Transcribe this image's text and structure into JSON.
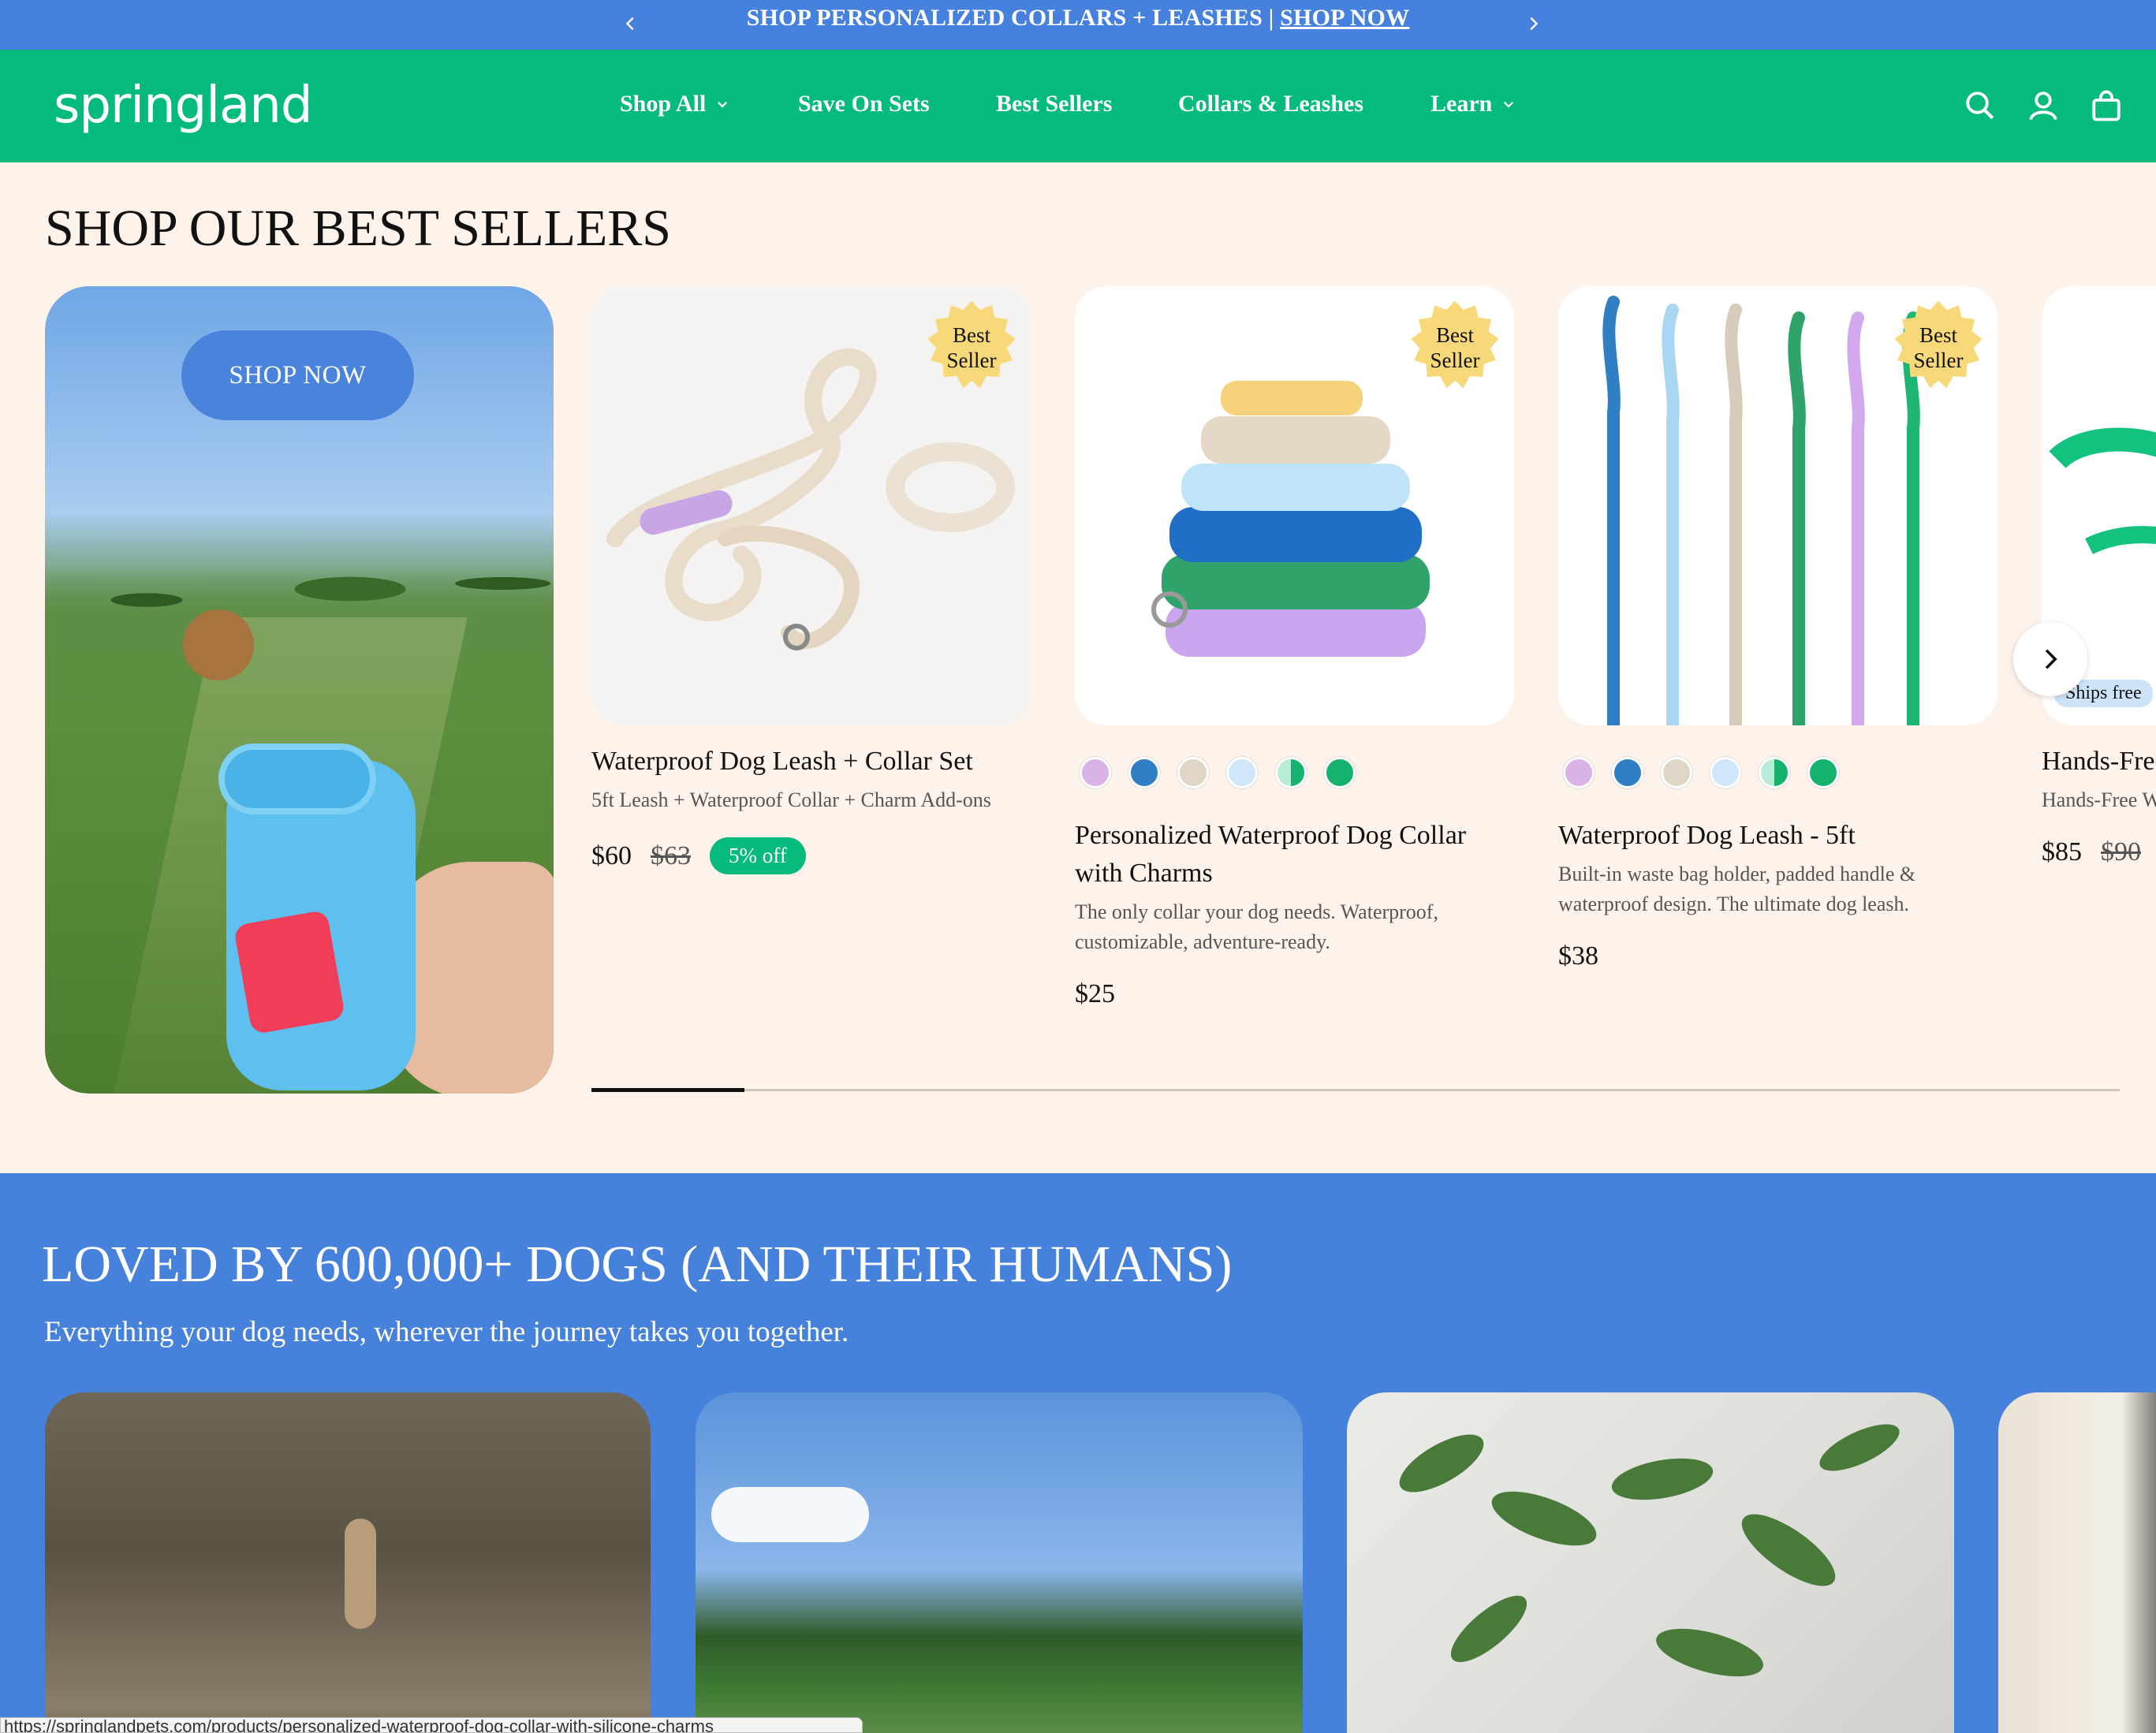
{
  "announcement": {
    "text": "SHOP PERSONALIZED COLLARS + LEASHES | ",
    "link": "SHOP NOW"
  },
  "header": {
    "logo": "springland",
    "nav": [
      {
        "label": "Shop All",
        "has_dropdown": true
      },
      {
        "label": "Save On Sets",
        "has_dropdown": false
      },
      {
        "label": "Best Sellers",
        "has_dropdown": false
      },
      {
        "label": "Collars & Leashes",
        "has_dropdown": false
      },
      {
        "label": "Learn",
        "has_dropdown": true
      }
    ],
    "icons": [
      "search-icon",
      "account-icon",
      "cart-icon"
    ]
  },
  "best_sellers": {
    "title": "SHOP OUR BEST SELLERS",
    "promo_button": "SHOP NOW",
    "products": [
      {
        "badge": "Best Seller",
        "name": "Waterproof Dog Leash + Collar Set",
        "desc": "5ft Leash + Waterproof Collar + Charm Add-ons",
        "price": "$60",
        "was": "$63",
        "discount": "5% off"
      },
      {
        "badge": "Best Seller",
        "name": "Personalized Waterproof Dog Collar with Charms",
        "desc": "The only collar your dog needs. Waterproof, customizable, adventure-ready.",
        "price": "$25",
        "swatches": [
          "#d9b3e6",
          "#2f7fc4",
          "#e0d6c6",
          "#cfe6fb",
          "split-mint-green",
          "#14b26c"
        ]
      },
      {
        "badge": "Best Seller",
        "name": "Waterproof Dog Leash - 5ft",
        "desc": "Built-in waste bag holder, padded handle & waterproof design. The ultimate dog leash.",
        "price": "$38",
        "swatches": [
          "#d9b3e6",
          "#2f7fc4",
          "#e0d6c6",
          "#cfe6fb",
          "split-mint-green",
          "#14b26c"
        ]
      },
      {
        "name": "Hands-Free Collar Set",
        "desc": "Hands-Free Waterproof",
        "price": "$85",
        "was": "$90",
        "tag": "Ships free"
      }
    ],
    "carousel_progress": 0.1
  },
  "loved": {
    "title": "LOVED BY 600,000+ DOGS (AND THEIR HUMANS)",
    "subtitle": "Everything your dog needs, wherever the journey takes you together."
  },
  "status_url": "https://springlandpets.com/products/personalized-waterproof-dog-collar-with-silicone-charms",
  "colors": {
    "brand_green": "#05bb7b",
    "brand_blue": "#4581dd",
    "background": "#fdf3ea",
    "badge_yellow": "#f7d97a"
  }
}
